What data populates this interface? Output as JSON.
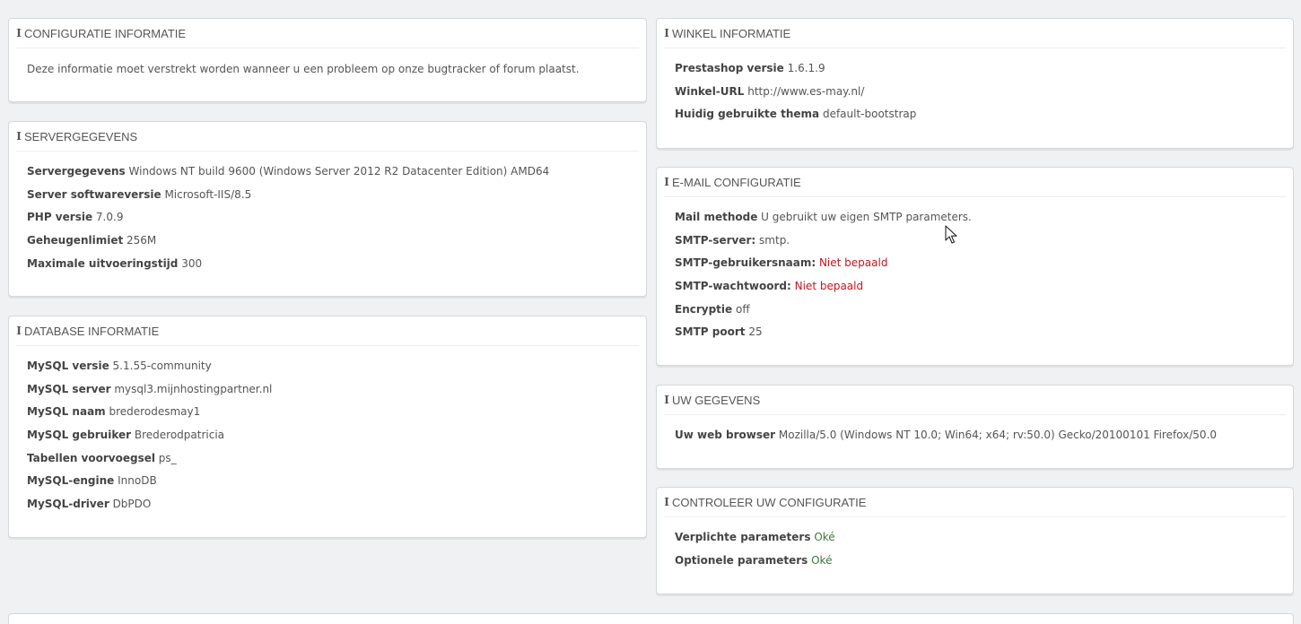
{
  "config_info": {
    "title": "CONFIGURATIE INFORMATIE",
    "text": "Deze informatie moet verstrekt worden wanneer u een probleem op onze bugtracker of forum plaatst."
  },
  "server": {
    "title": "SERVERGEGEVENS",
    "rows": [
      {
        "label": "Servergegevens",
        "value": "Windows NT build 9600 (Windows Server 2012 R2 Datacenter Edition) AMD64"
      },
      {
        "label": "Server softwareversie",
        "value": "Microsoft-IIS/8.5"
      },
      {
        "label": "PHP versie",
        "value": "7.0.9"
      },
      {
        "label": "Geheugenlimiet",
        "value": "256M"
      },
      {
        "label": "Maximale uitvoeringstijd",
        "value": "300"
      }
    ]
  },
  "database": {
    "title": "DATABASE INFORMATIE",
    "rows": [
      {
        "label": "MySQL versie",
        "value": "5.1.55-community"
      },
      {
        "label": "MySQL server",
        "value": "mysql3.mijnhostingpartner.nl"
      },
      {
        "label": "MySQL naam",
        "value": "brederodesmay1"
      },
      {
        "label": "MySQL gebruiker",
        "value": "Brederodpatricia"
      },
      {
        "label": "Tabellen voorvoegsel",
        "value": "ps_"
      },
      {
        "label": "MySQL-engine",
        "value": "InnoDB"
      },
      {
        "label": "MySQL-driver",
        "value": "DbPDO"
      }
    ]
  },
  "shop": {
    "title": "WINKEL INFORMATIE",
    "rows": [
      {
        "label": "Prestashop versie",
        "value": "1.6.1.9"
      },
      {
        "label": "Winkel-URL",
        "value": "http://www.es-may.nl/"
      },
      {
        "label": "Huidig gebruikte thema",
        "value": "default-bootstrap"
      }
    ]
  },
  "email": {
    "title": "E-MAIL CONFIGURATIE",
    "rows": [
      {
        "label": "Mail methode",
        "value": "U gebruikt uw eigen SMTP parameters."
      },
      {
        "label": "SMTP-server:",
        "value": "smtp."
      },
      {
        "label": "SMTP-gebruikersnaam:",
        "value": "Niet bepaald"
      },
      {
        "label": "SMTP-wachtwoord:",
        "value": "Niet bepaald"
      },
      {
        "label": "Encryptie",
        "value": "off"
      },
      {
        "label": "SMTP poort",
        "value": "25"
      }
    ]
  },
  "user": {
    "title": "UW GEGEVENS",
    "rows": [
      {
        "label": "Uw web browser",
        "value": "Mozilla/5.0 (Windows NT 10.0; Win64; x64; rv:50.0) Gecko/20100101 Firefox/50.0"
      }
    ]
  },
  "check": {
    "title": "CONTROLEER UW CONFIGURATIE",
    "rows": [
      {
        "label": "Verplichte parameters",
        "value": "Oké"
      },
      {
        "label": "Optionele parameters",
        "value": "Oké"
      }
    ]
  },
  "colors": {
    "error": "#c7161d",
    "ok": "#3c763d"
  },
  "icons": {
    "panel_icon": "info-icon",
    "pointer": "mouse-pointer-icon"
  }
}
